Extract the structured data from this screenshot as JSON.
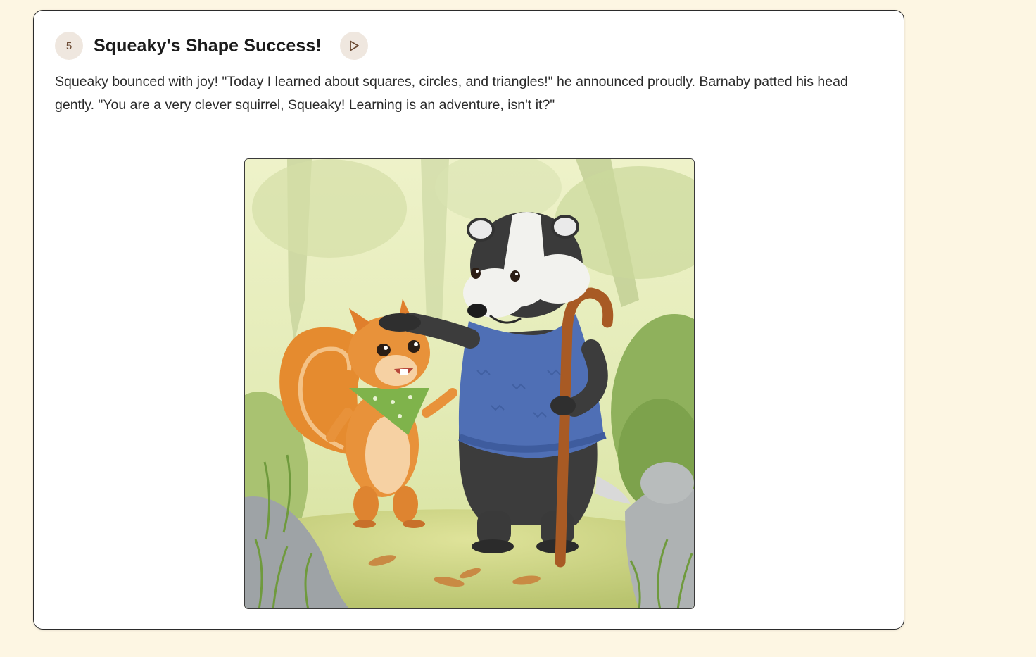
{
  "story_page": {
    "page_number": "5",
    "title": "Squeaky's Shape Success!",
    "play_icon": "play-icon",
    "text": "Squeaky bounced with joy! \"Today I learned about squares, circles, and triangles!\" he announced proudly. Barnaby patted his head gently. \"You are a very clever squirrel, Squeaky! Learning is an adventure, isn't it?\"",
    "illustration_icon": "squirrel-and-badger-illustration"
  },
  "colors": {
    "page_background": "#fdf6e3",
    "card_background": "#ffffff",
    "badge_background": "#efe7df",
    "accent_brown": "#6b4a33"
  }
}
